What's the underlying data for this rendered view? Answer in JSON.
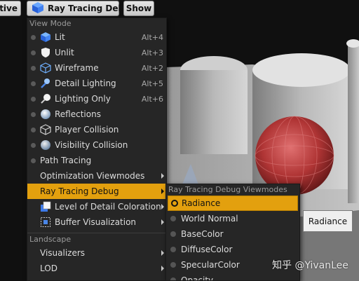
{
  "toolbar": {
    "perspective_label": "ective",
    "view_mode_label": "Ray Tracing Debug",
    "show_label": "Show"
  },
  "view_mode_menu": {
    "section_title": "View Mode",
    "items": [
      {
        "label": "Lit",
        "shortcut": "Alt+4",
        "icon": "lit-cube-icon"
      },
      {
        "label": "Unlit",
        "shortcut": "Alt+3",
        "icon": "unlit-shield-icon"
      },
      {
        "label": "Wireframe",
        "shortcut": "Alt+2",
        "icon": "wireframe-cube-icon"
      },
      {
        "label": "Detail Lighting",
        "shortcut": "Alt+5",
        "icon": "detail-lighting-icon"
      },
      {
        "label": "Lighting Only",
        "shortcut": "Alt+6",
        "icon": "lighting-only-icon"
      },
      {
        "label": "Reflections",
        "icon": "reflection-sphere-icon"
      },
      {
        "label": "Player Collision",
        "icon": "player-collision-icon"
      },
      {
        "label": "Visibility Collision",
        "icon": "visibility-collision-icon"
      },
      {
        "label": "Path Tracing"
      },
      {
        "label": "Optimization Viewmodes",
        "has_submenu": true
      },
      {
        "label": "Ray Tracing Debug",
        "has_submenu": true,
        "highlighted": true
      },
      {
        "label": "Level of Detail Coloration",
        "has_submenu": true,
        "icon": "lod-coloration-icon"
      },
      {
        "label": "Buffer Visualization",
        "has_submenu": true,
        "icon": "buffer-visualization-icon"
      }
    ],
    "landscape_title": "Landscape",
    "landscape_items": [
      {
        "label": "Visualizers",
        "has_submenu": true
      },
      {
        "label": "LOD",
        "has_submenu": true
      }
    ]
  },
  "ray_tracing_submenu": {
    "section_title": "Ray Tracing Debug Viewmodes",
    "items": [
      {
        "label": "Radiance",
        "selected": true
      },
      {
        "label": "World Normal"
      },
      {
        "label": "BaseColor"
      },
      {
        "label": "DiffuseColor"
      },
      {
        "label": "SpecularColor"
      },
      {
        "label": "Opacity"
      }
    ]
  },
  "tooltip": {
    "text": "Radiance"
  },
  "watermark": {
    "text": "知乎 @YivanLee"
  },
  "colors": {
    "highlight": "#e3a00e",
    "menu_bg": "#262626",
    "sphere_red": "#c0403f"
  }
}
